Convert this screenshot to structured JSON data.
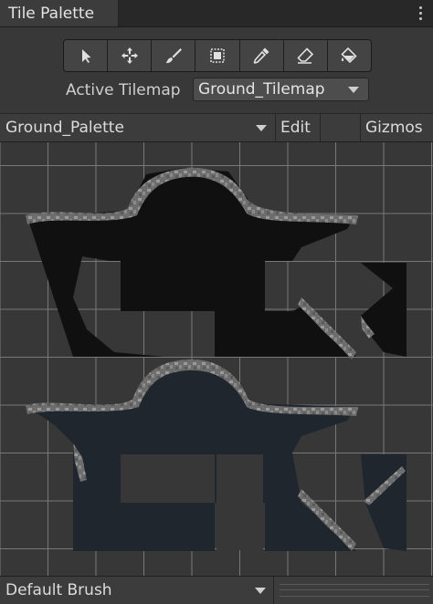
{
  "window": {
    "tab_title": "Tile Palette",
    "menu_icon": "kebab-menu-icon"
  },
  "toolbar": {
    "tools": [
      {
        "name": "select",
        "icon": "arrow-pointer-icon"
      },
      {
        "name": "move",
        "icon": "move-arrows-icon"
      },
      {
        "name": "paint",
        "icon": "paintbrush-icon"
      },
      {
        "name": "box-fill",
        "icon": "box-fill-icon"
      },
      {
        "name": "pick",
        "icon": "eyedropper-icon"
      },
      {
        "name": "erase",
        "icon": "eraser-icon"
      },
      {
        "name": "fill",
        "icon": "paint-bucket-icon"
      }
    ]
  },
  "active_tilemap": {
    "label": "Active Tilemap",
    "selected": "Ground_Tilemap"
  },
  "palette_bar": {
    "selected_palette": "Ground_Palette",
    "edit_label": "Edit",
    "gizmos_label": "Gizmos"
  },
  "brush_bar": {
    "selected_brush": "Default Brush"
  },
  "colors": {
    "panel_bg": "#383838",
    "grid_line": "#787878",
    "tile_dark": "#0f0f0f",
    "tile_blue": "#1f262e",
    "rock": "#7a7a7a"
  }
}
